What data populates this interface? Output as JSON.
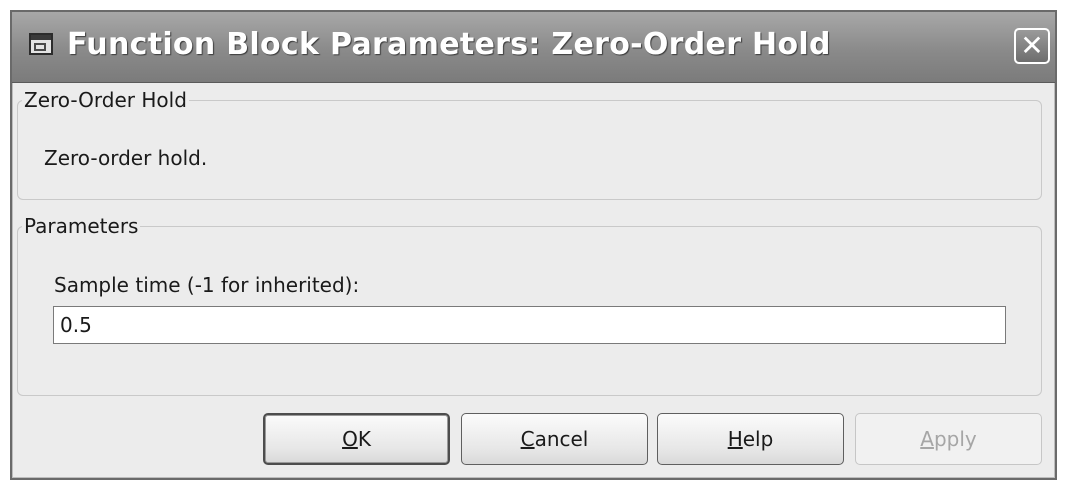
{
  "window": {
    "title": "Function Block Parameters: Zero-Order Hold",
    "icon": "simulink-block-icon",
    "close_glyph": "✕"
  },
  "block_group": {
    "legend": "Zero-Order Hold",
    "description": "Zero-order hold."
  },
  "parameters_group": {
    "legend": "Parameters",
    "sample_time_label": "Sample time (-1 for inherited):",
    "sample_time_value": "0.5"
  },
  "buttons": {
    "ok": {
      "mnemonic": "O",
      "rest": "K",
      "enabled": true
    },
    "cancel": {
      "mnemonic": "C",
      "rest": "ancel",
      "enabled": true
    },
    "help": {
      "mnemonic": "H",
      "rest": "elp",
      "enabled": true
    },
    "apply": {
      "mnemonic": "A",
      "rest": "pply",
      "enabled": false
    }
  }
}
